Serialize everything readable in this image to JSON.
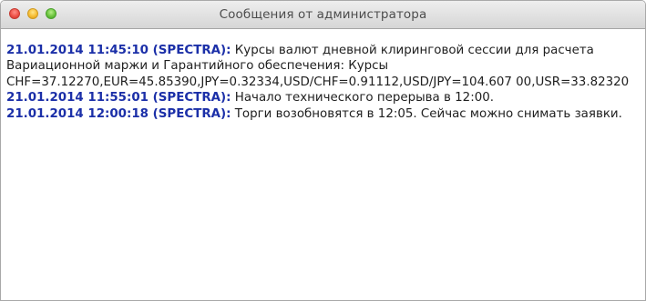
{
  "window": {
    "title": "Сообщения от администратора"
  },
  "messages": [
    {
      "stamp": "21.01.2014 11:45:10 (SPECTRA):",
      "text": " Курсы валют дневной клиринговой сессии для расчета Вариационной маржи и Гарантийного обеспечения: Курсы CHF=37.12270,EUR=45.85390,JPY=0.32334,USD/CHF=0.91112,USD/JPY=104.607 00,USR=33.82320"
    },
    {
      "stamp": "21.01.2014 11:55:01 (SPECTRA):",
      "text": " Начало технического перерыва в 12:00."
    },
    {
      "stamp": "21.01.2014 12:00:18 (SPECTRA):",
      "text": " Торги возобновятся в 12:05. Сейчас можно снимать заявки."
    }
  ]
}
